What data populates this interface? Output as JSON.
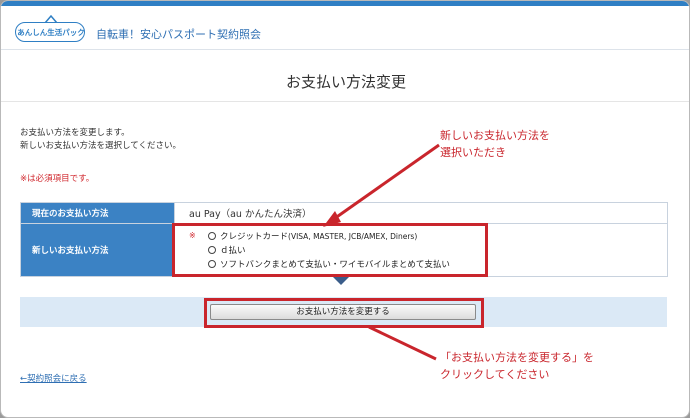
{
  "header": {
    "logo_text": "あんしん生活パック",
    "app_title": "自転車！安心パスポート契約照会"
  },
  "page": {
    "title": "お支払い方法変更",
    "intro_line1": "お支払い方法を変更します。",
    "intro_line2": "新しいお支払い方法を選択してください。",
    "required_note": "※は必須項目です。"
  },
  "form": {
    "current_label": "現在のお支払い方法",
    "current_value": "au Pay（au かんたん決済）",
    "new_label": "新しいお支払い方法",
    "required_mark": "※",
    "options": [
      {
        "label": "クレジットカード",
        "sub": "(VISA, MASTER, JCB/AMEX, Diners)"
      },
      {
        "label": "ｄ払い",
        "sub": ""
      },
      {
        "label": "ソフトバンクまとめて支払い・ワイモバイルまとめて支払い",
        "sub": ""
      }
    ],
    "submit_label": "お支払い方法を変更する"
  },
  "nav": {
    "back_label": "←契約照会に戻る"
  },
  "annotations": {
    "callout1_line1": "新しいお支払い方法を",
    "callout1_line2": "選択いただき",
    "callout2_line1": "「お支払い方法を変更する」を",
    "callout2_line2": "クリックしてください"
  },
  "colors": {
    "brand_blue": "#2f7fc4",
    "label_blue": "#3b82c4",
    "annotation_red": "#c9252c",
    "required_red": "#d0282e",
    "action_bar": "#dbe9f6"
  },
  "icons": {
    "logo": "house-logo-icon",
    "dropdown_arrow": "triangle-down-icon"
  }
}
